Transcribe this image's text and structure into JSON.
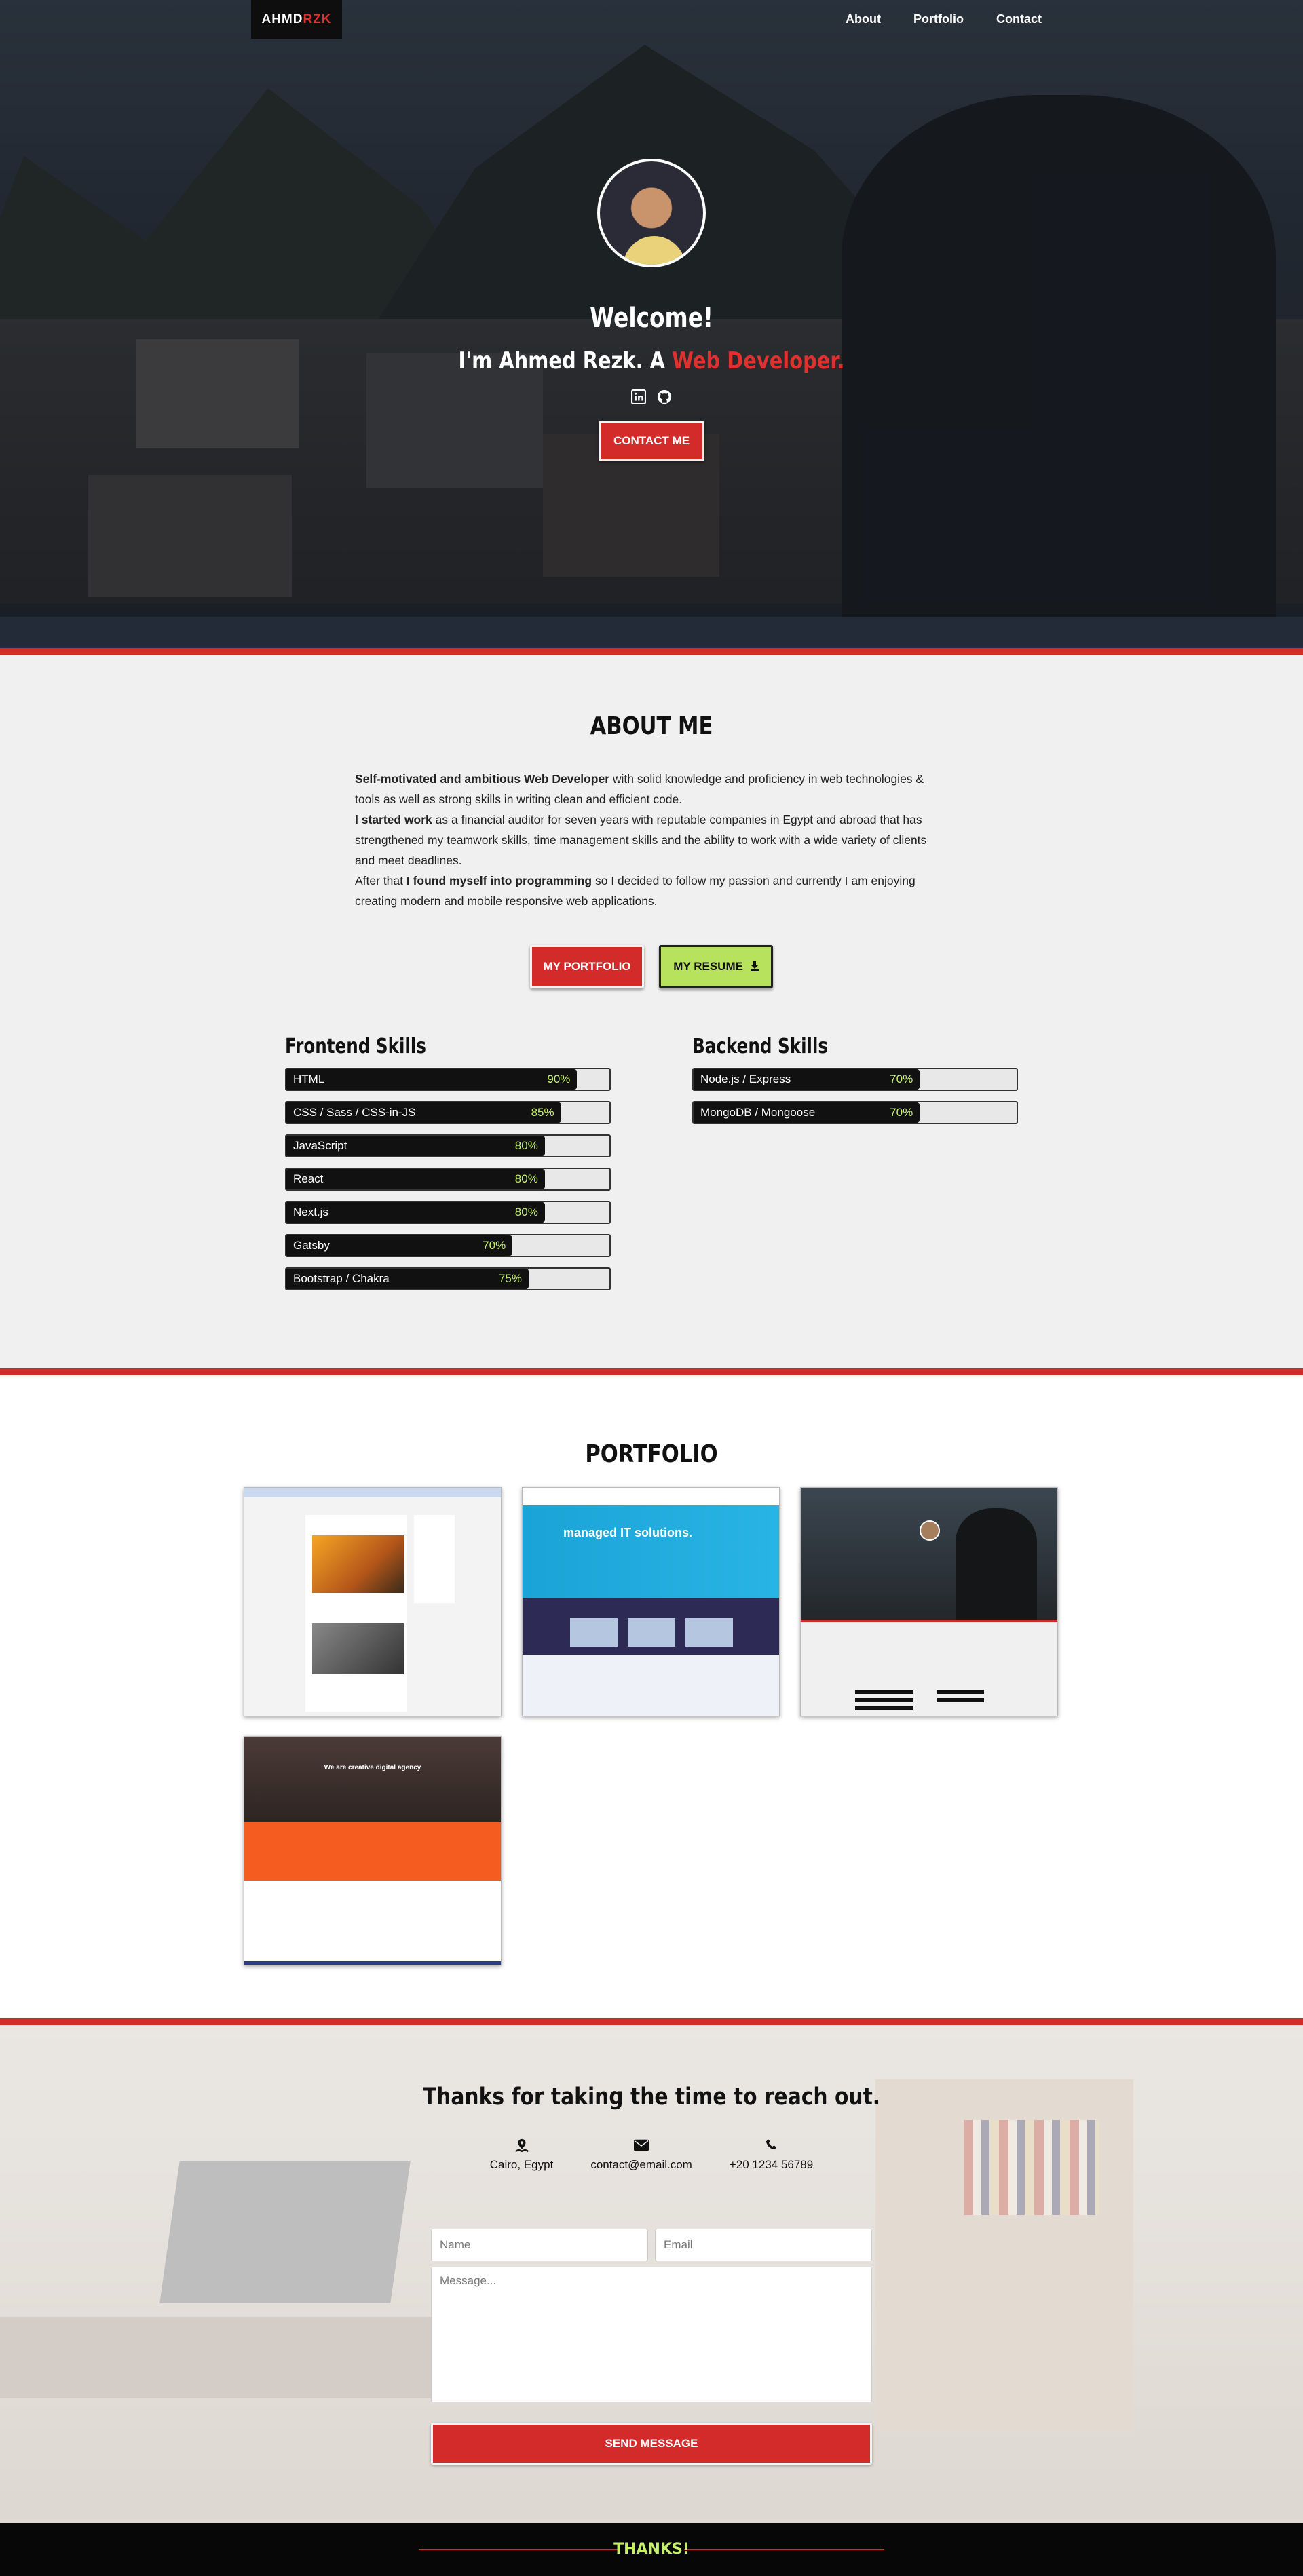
{
  "nav": {
    "logo_part1": "AHMD",
    "logo_part2": "RZK",
    "links": [
      "About",
      "Portfolio",
      "Contact"
    ]
  },
  "hero": {
    "welcome": "Welcome!",
    "tagline_prefix": "I'm Ahmed Rezk. A ",
    "tagline_highlight": "Web Developer.",
    "social_icons": [
      "linkedin-icon",
      "github-icon"
    ],
    "contact_button": "CONTACT ME"
  },
  "about": {
    "title": "ABOUT ME",
    "p1_bold": "Self-motivated and ambitious Web Developer",
    "p1_rest": " with solid knowledge and proficiency in web technologies & tools as well as strong skills in writing clean and efficient code.",
    "p2_bold": "I started work",
    "p2_rest": " as a financial auditor for seven years with reputable companies in Egypt and abroad that has strengthened my teamwork skills, time management skills and the ability to work with a wide variety of clients and meet deadlines.",
    "p3_prefix": "After that ",
    "p3_bold": "I found myself into programming",
    "p3_rest": " so I decided to follow my passion and currently I am enjoying creating modern and mobile responsive web applications.",
    "portfolio_button": "MY PORTFOLIO",
    "resume_button": "MY RESUME",
    "resume_icon": "download-icon"
  },
  "skills": {
    "frontend_title": "Frontend Skills",
    "backend_title": "Backend Skills",
    "frontend": [
      {
        "name": "HTML",
        "pct": "90%",
        "value": 90
      },
      {
        "name": "CSS / Sass / CSS-in-JS",
        "pct": "85%",
        "value": 85
      },
      {
        "name": "JavaScript",
        "pct": "80%",
        "value": 80
      },
      {
        "name": "React",
        "pct": "80%",
        "value": 80
      },
      {
        "name": "Next.js",
        "pct": "80%",
        "value": 80
      },
      {
        "name": "Gatsby",
        "pct": "70%",
        "value": 70
      },
      {
        "name": "Bootstrap / Chakra",
        "pct": "75%",
        "value": 75
      }
    ],
    "backend": [
      {
        "name": "Node.js / Express",
        "pct": "70%",
        "value": 70
      },
      {
        "name": "MongoDB / Mongoose",
        "pct": "70%",
        "value": 70
      }
    ]
  },
  "portfolio": {
    "title": "PORTFOLIO",
    "thumb_it_text": "managed IT solutions.",
    "thumb_agency_text": "We are creative digital agency"
  },
  "contact": {
    "title": "Thanks for taking the time to reach out.",
    "location": "Cairo, Egypt",
    "email": "contact@email.com",
    "phone": "+20 1234 56789",
    "name_placeholder": "Name",
    "email_placeholder": "Email",
    "message_placeholder": "Message...",
    "send_button": "SEND MESSAGE"
  },
  "footer": {
    "text": "THANKS!"
  },
  "colors": {
    "accent_red": "#d32a2a",
    "accent_green": "#b7e25e",
    "percent_text": "#c6f06c"
  }
}
